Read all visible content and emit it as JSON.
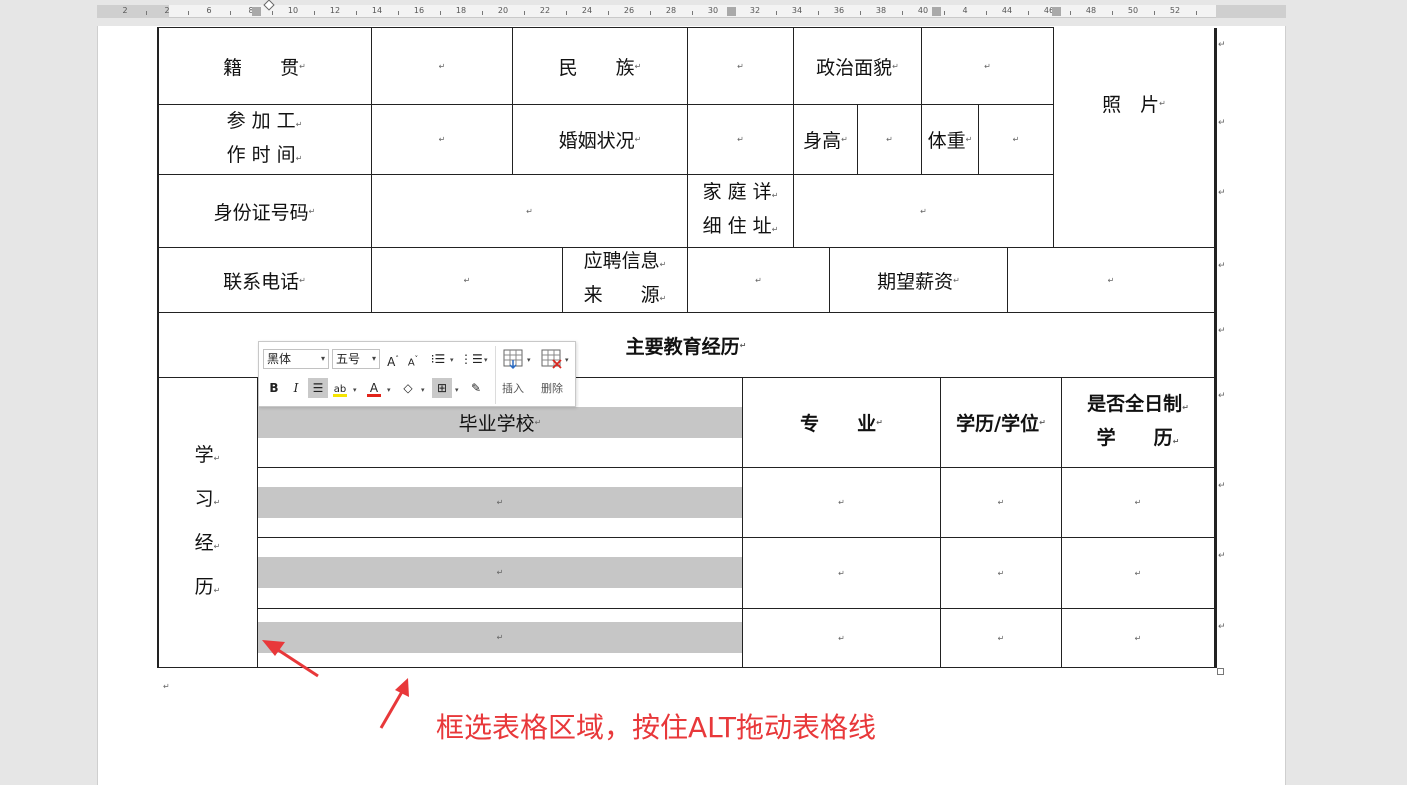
{
  "ruler": {
    "labels": [
      "2",
      "2",
      "6",
      "8",
      "10",
      "12",
      "14",
      "16",
      "18",
      "20",
      "22",
      "24",
      "26",
      "28",
      "30",
      "32",
      "34",
      "36",
      "38",
      "40",
      "4",
      "44",
      "46",
      "48",
      "50",
      "52"
    ]
  },
  "form": {
    "jiguan": "籍　　贯",
    "minzu": "民　　族",
    "zhengzhi": "政治面貌",
    "photo": "照　片",
    "canjia_line1": "参 加 工",
    "canjia_line2": "作 时 间",
    "hunyin": "婚姻状况",
    "shengao": "身高",
    "tizhong": "体重",
    "shenfenzheng": "身份证号码",
    "jiating_line1": "家 庭 详",
    "jiating_line2": "细 住 址",
    "dianhua": "联系电话",
    "yingpin_line1": "应聘信息",
    "yingpin_line2": "来　　源",
    "xinzi": "期望薪资",
    "edu_title": "主要教育经历",
    "xuexi": [
      "学",
      "习",
      "经",
      "历"
    ],
    "school": "毕业学校",
    "major": "专　　业",
    "degree": "学历/学位",
    "fulltime_line1": "是否全日制",
    "fulltime_line2": "学　　历",
    "paragraph_mark": "↵"
  },
  "mini_toolbar": {
    "font_name": "黑体",
    "font_size": "五号",
    "grow_font": "A",
    "shrink_font": "A",
    "bold": "B",
    "italic": "I",
    "insert": "插入",
    "delete": "删除",
    "colors": {
      "highlight": "#f5e400",
      "font_color": "#e2231a"
    }
  },
  "annotation": {
    "text": "框选表格区域，按住ALT拖动表格线",
    "color": "#e8383a"
  }
}
